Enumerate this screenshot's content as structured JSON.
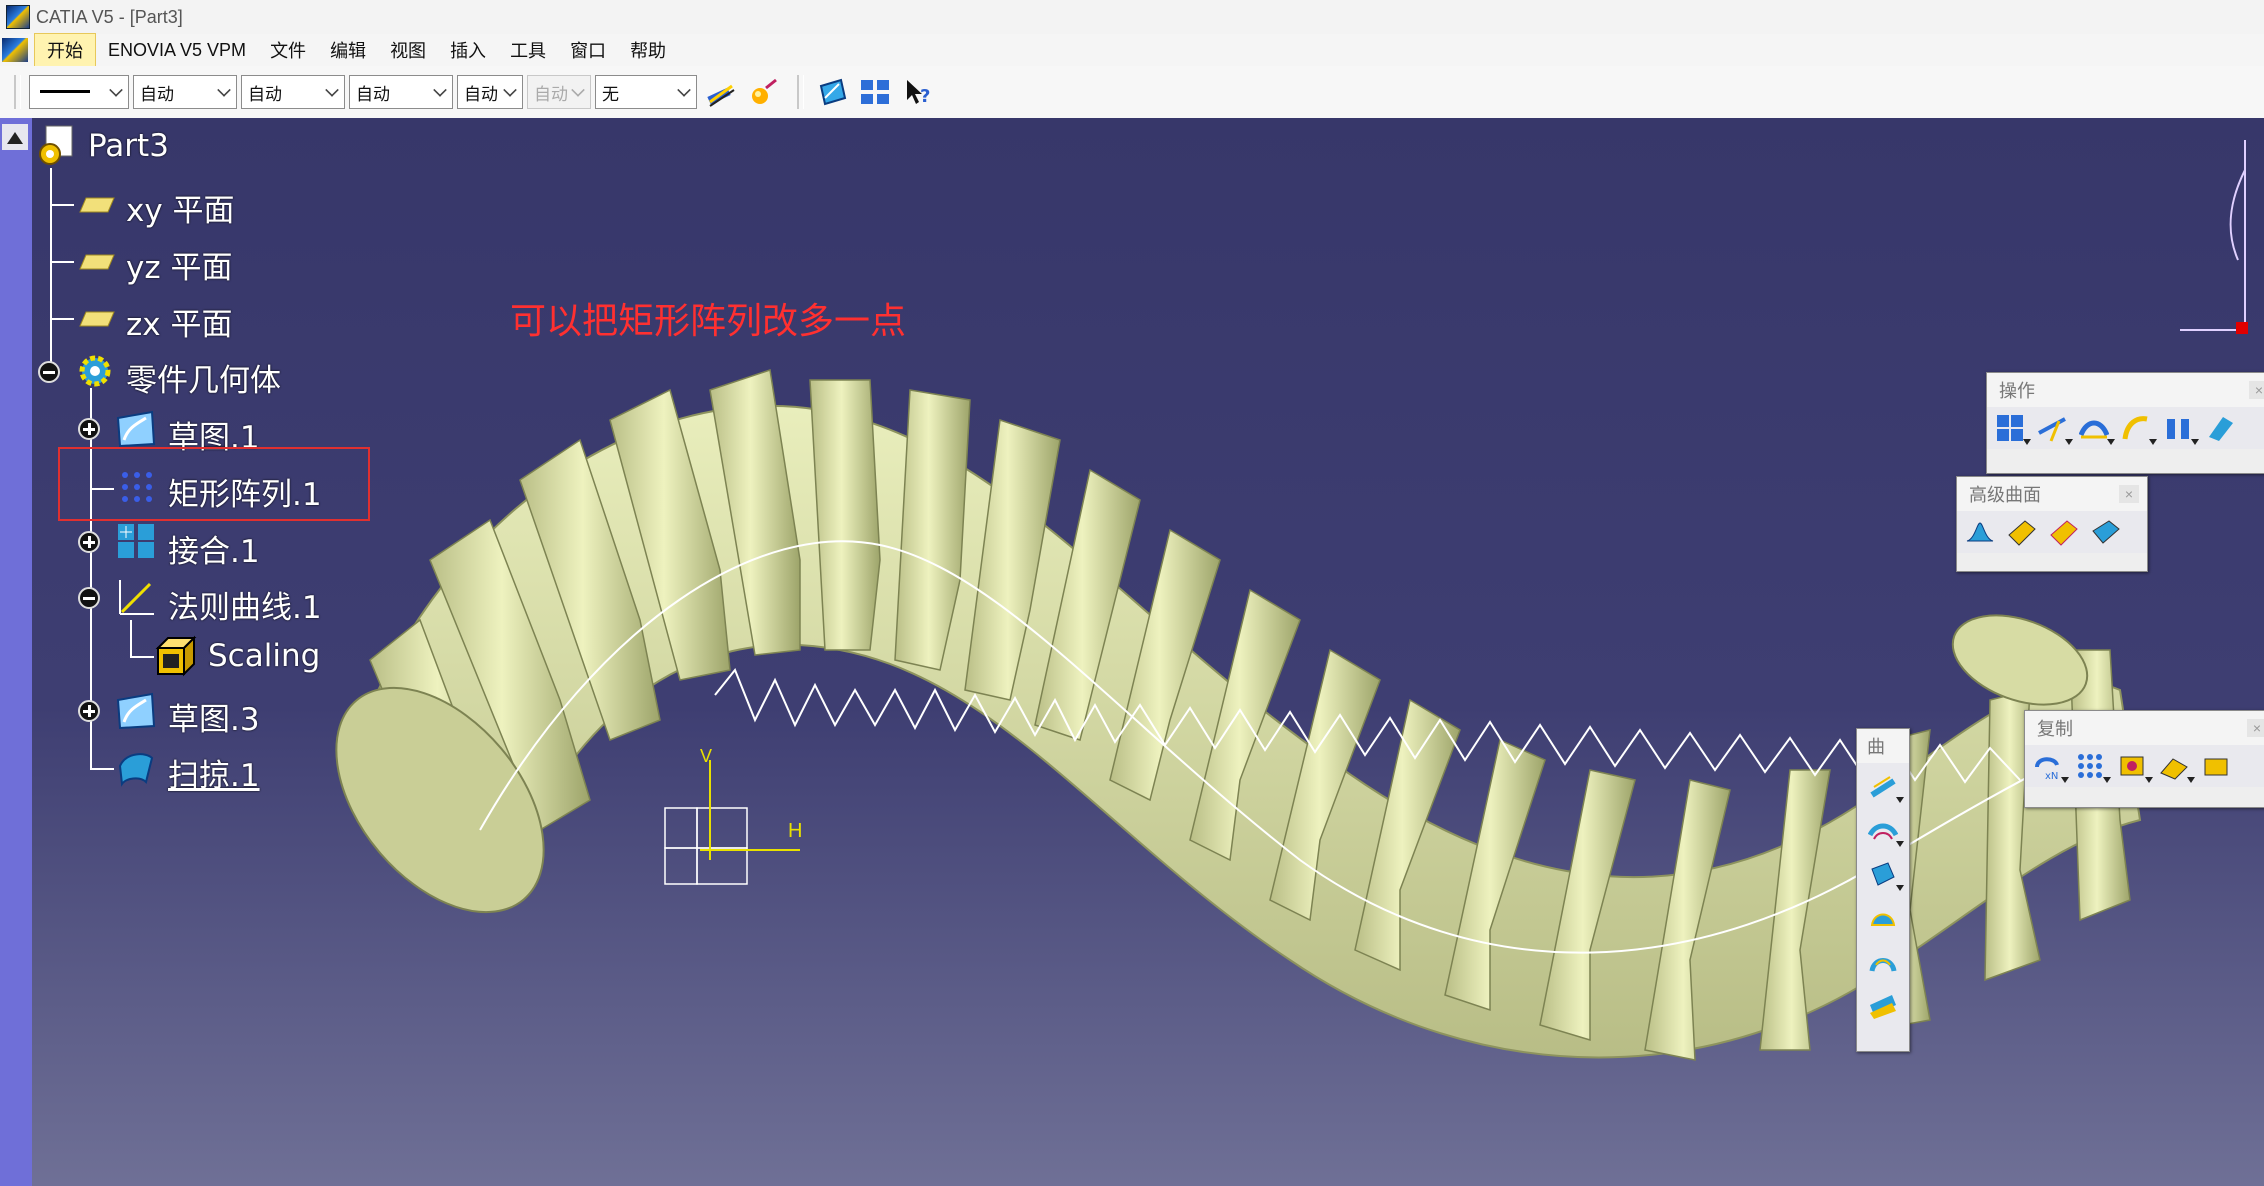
{
  "window": {
    "title": "CATIA V5 - [Part3]"
  },
  "menu": {
    "items": [
      "开始",
      "ENOVIA V5 VPM",
      "文件",
      "编辑",
      "视图",
      "插入",
      "工具",
      "窗口",
      "帮助"
    ]
  },
  "toolbar": {
    "combos": [
      "",
      "自动",
      "自动",
      "自动",
      "自动",
      "自动",
      "无"
    ],
    "disabled_combo_index": 5
  },
  "tree": {
    "root": "Part3",
    "nodes": {
      "xy": "xy 平面",
      "yz": "yz 平面",
      "zx": "zx 平面",
      "body": "零件几何体",
      "sketch1": "草图.1",
      "pattern": "矩形阵列.1",
      "join": "接合.1",
      "law": "法则曲线.1",
      "scaling": "Scaling",
      "sketch3": "草图.3",
      "sweep": "扫掠.1"
    }
  },
  "annotation": "可以把矩形阵列改多一点",
  "floating_toolbars": {
    "operations": "操作",
    "advanced_surfaces": "高级曲面",
    "copy": "复制",
    "surfaces_small": "曲"
  },
  "axis_labels": {
    "v": "V",
    "h": "H"
  },
  "colors": {
    "background_top": "#37376a",
    "background_bottom": "#6f7096",
    "part_color": "#dfe5a8",
    "annotation": "#ff3030",
    "highlight": "#e03030"
  }
}
